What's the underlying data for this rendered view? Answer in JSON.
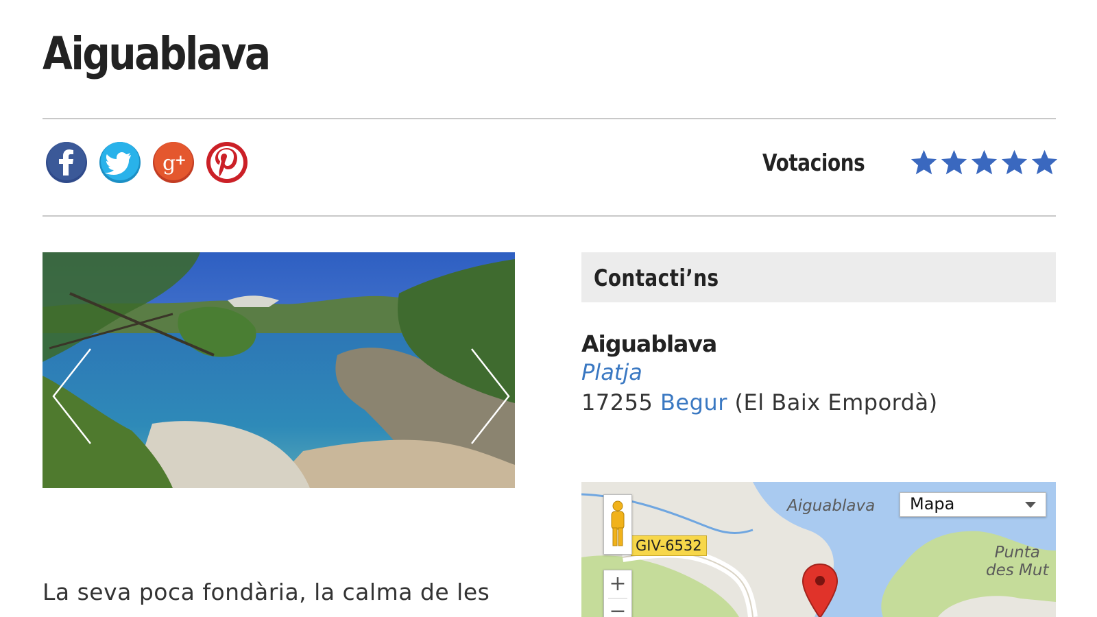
{
  "page": {
    "title": "Aiguablava"
  },
  "share": {
    "buttons": [
      {
        "name": "facebook",
        "glyph": "f",
        "color": "#3b5998"
      },
      {
        "name": "twitter",
        "glyph": "t",
        "color": "#29a9e1"
      },
      {
        "name": "google-plus",
        "glyph": "g+",
        "color": "#dd4b39"
      },
      {
        "name": "pinterest",
        "glyph": "p",
        "color": "#cb2027"
      }
    ]
  },
  "rating": {
    "label": "Votacions",
    "stars_filled": 5,
    "stars_total": 5,
    "star_color": "#3a68bf"
  },
  "gallery": {
    "prev_icon": "chevron-left-icon",
    "next_icon": "chevron-right-icon"
  },
  "contact": {
    "header": "Contacti’ns",
    "name": "Aiguablava",
    "type": "Platja",
    "postal_code": "17255",
    "town": "Begur",
    "region": "(El Baix Empordà)"
  },
  "map": {
    "place_label": "Aiguablava",
    "point_label_line1": "Punta",
    "point_label_line2": "des Mut",
    "map_type": "Mapa",
    "road": "GIV-6532",
    "zoom_in": "+",
    "zoom_out": "−"
  },
  "description": {
    "first_line": "La seva poca fondària, la calma de les"
  },
  "colors": {
    "accent_link": "#3a78c2",
    "water": "#a9caf0",
    "land": "#e8e6df",
    "green": "#c5dc9a"
  }
}
